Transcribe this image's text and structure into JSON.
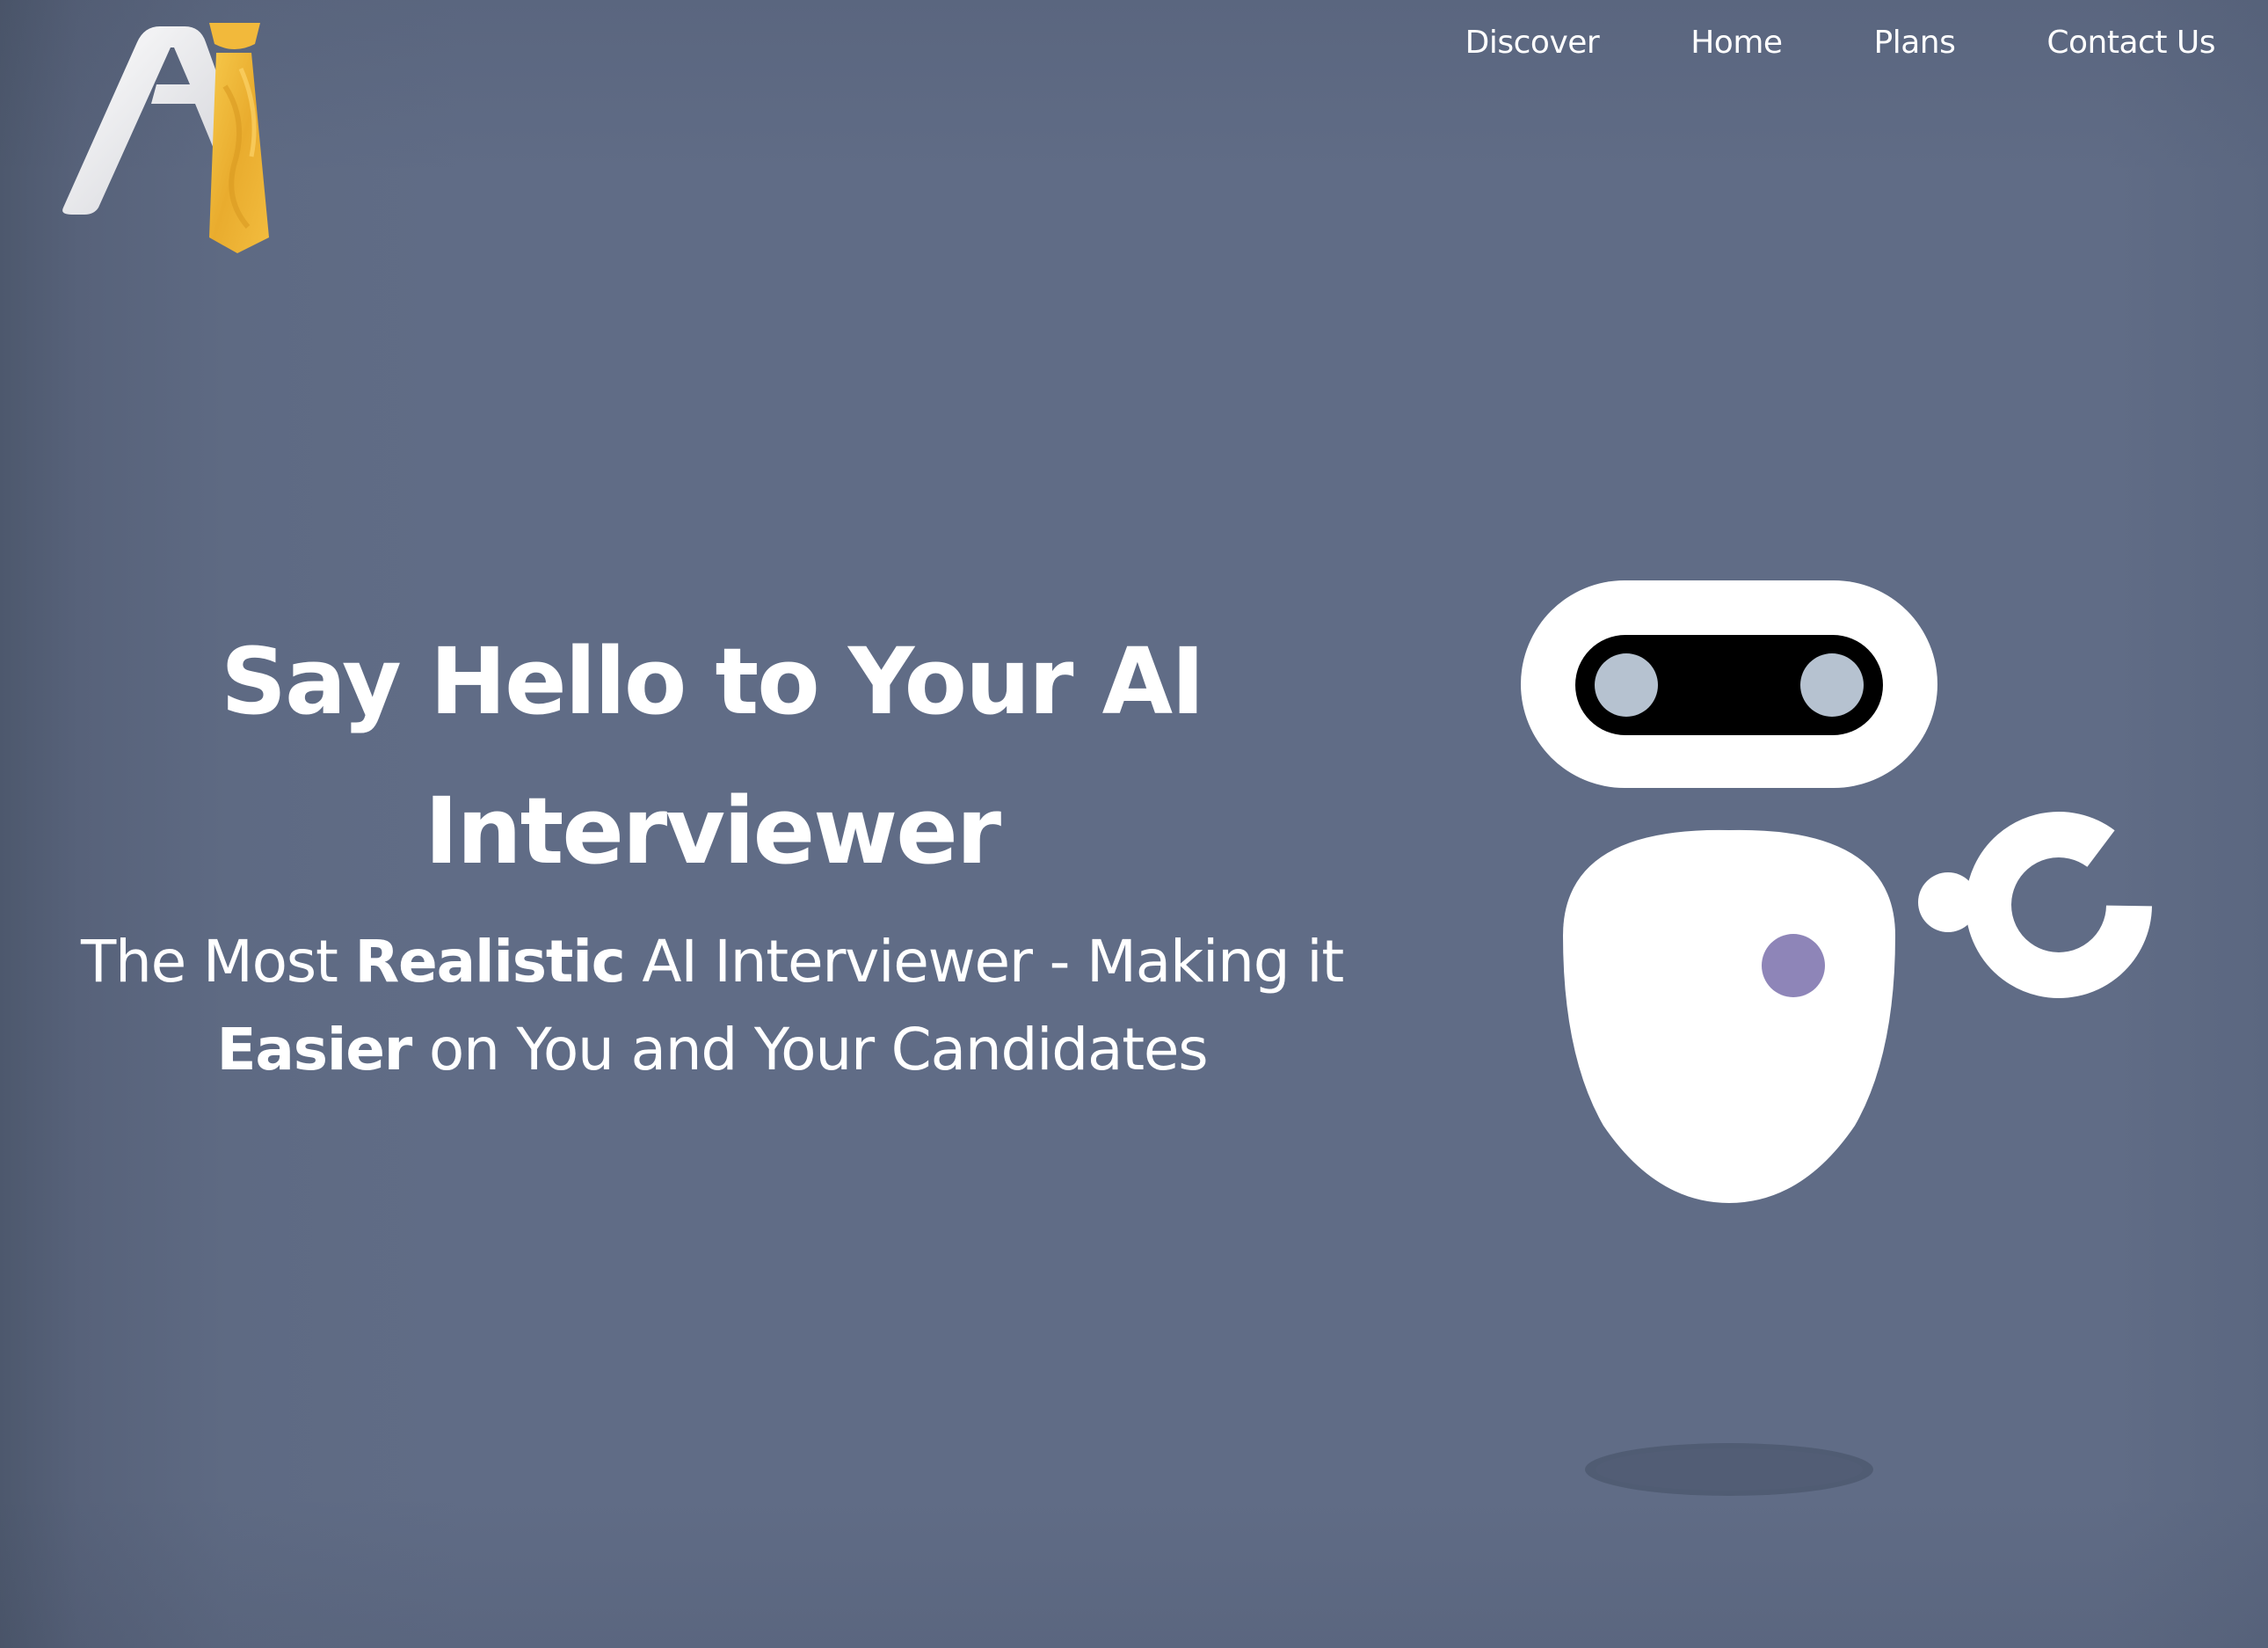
{
  "brand": {
    "logo_name": "ai-tie-logo",
    "colors": {
      "background": "#606c86",
      "tie_gold": "#f2b93b",
      "letter_white": "#f4f4f6",
      "robot_eye": "#b6c2d0",
      "robot_dot": "#8e85b8"
    }
  },
  "nav": {
    "items": [
      {
        "label": "Discover"
      },
      {
        "label": "Home"
      },
      {
        "label": "Plans"
      },
      {
        "label": "Contact Us"
      }
    ]
  },
  "hero": {
    "title_line1": "Say Hello to Your AI",
    "title_line2": "Interviewer",
    "sub_part1": "The Most ",
    "sub_bold1": "Realistic",
    "sub_part2": " AI Interviewer - Making it",
    "sub_bold2": "Easier",
    "sub_part3": " on You and Your Candidates"
  },
  "illustration": {
    "name": "robot-illustration"
  }
}
